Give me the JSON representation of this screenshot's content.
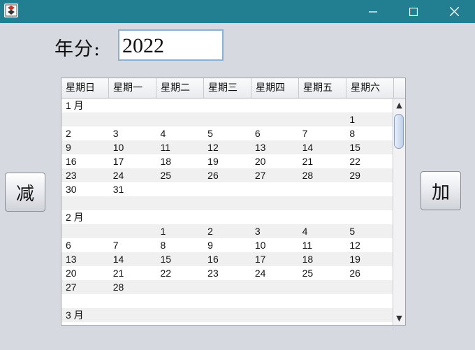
{
  "window": {
    "minimize_glyph": "—",
    "maximize_glyph": "☐",
    "close_glyph": "✕"
  },
  "year": {
    "label": "年分:",
    "value": "2022"
  },
  "buttons": {
    "decrease": "减",
    "increase": "加"
  },
  "table": {
    "headers": [
      "星期日",
      "星期一",
      "星期二",
      "星期三",
      "星期四",
      "星期五",
      "星期六"
    ],
    "rows": [
      [
        "1 月",
        "",
        "",
        "",
        "",
        "",
        ""
      ],
      [
        "",
        "",
        "",
        "",
        "",
        "",
        "1"
      ],
      [
        "2",
        "3",
        "4",
        "5",
        "6",
        "7",
        "8"
      ],
      [
        "9",
        "10",
        "11",
        "12",
        "13",
        "14",
        "15"
      ],
      [
        "16",
        "17",
        "18",
        "19",
        "20",
        "21",
        "22"
      ],
      [
        "23",
        "24",
        "25",
        "26",
        "27",
        "28",
        "29"
      ],
      [
        "30",
        "31",
        "",
        "",
        "",
        "",
        ""
      ],
      [
        "",
        "",
        "",
        "",
        "",
        "",
        ""
      ],
      [
        "2 月",
        "",
        "",
        "",
        "",
        "",
        ""
      ],
      [
        "",
        "",
        "1",
        "2",
        "3",
        "4",
        "5"
      ],
      [
        "6",
        "7",
        "8",
        "9",
        "10",
        "11",
        "12"
      ],
      [
        "13",
        "14",
        "15",
        "16",
        "17",
        "18",
        "19"
      ],
      [
        "20",
        "21",
        "22",
        "23",
        "24",
        "25",
        "26"
      ],
      [
        "27",
        "28",
        "",
        "",
        "",
        "",
        ""
      ],
      [
        "",
        "",
        "",
        "",
        "",
        "",
        ""
      ],
      [
        "3 月",
        "",
        "",
        "",
        "",
        "",
        ""
      ]
    ]
  },
  "scroll": {
    "up_glyph": "▲",
    "down_glyph": "▼"
  },
  "colors": {
    "titlebar": "#227f91",
    "background": "#d6d9e0"
  }
}
